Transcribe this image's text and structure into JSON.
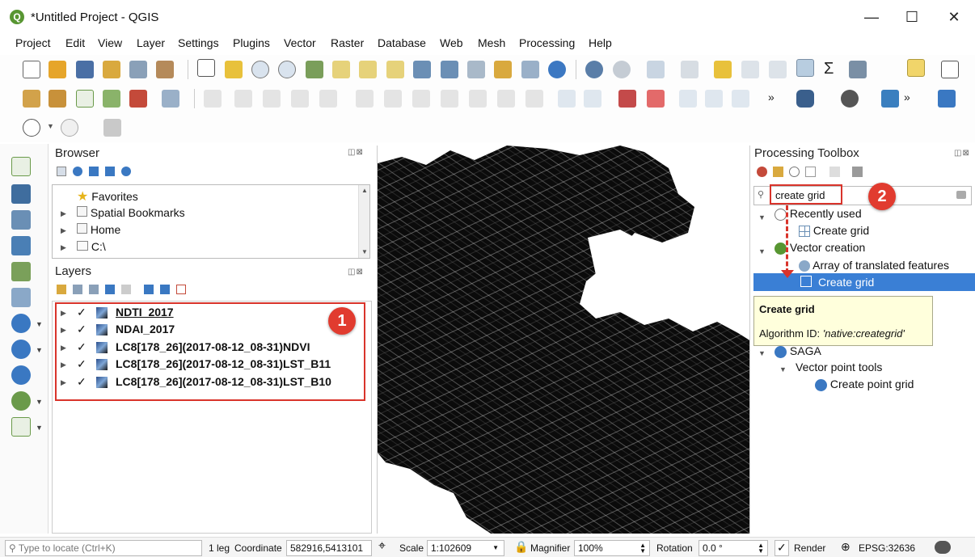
{
  "window": {
    "title": "*Untitled Project - QGIS",
    "logo_letter": "Q",
    "minimize": "—",
    "maximize": "☐",
    "close": "✕"
  },
  "menu": [
    "Project",
    "Edit",
    "View",
    "Layer",
    "Settings",
    "Plugins",
    "Vector",
    "Raster",
    "Database",
    "Web",
    "Mesh",
    "Processing",
    "Help"
  ],
  "browser": {
    "title": "Browser",
    "items": [
      {
        "label": "Favorites",
        "icon": "star-icon"
      },
      {
        "label": "Spatial Bookmarks",
        "icon": "bookmark-icon"
      },
      {
        "label": "Home",
        "icon": "home-folder-icon"
      },
      {
        "label": "C:\\",
        "icon": "folder-icon"
      }
    ]
  },
  "layers": {
    "title": "Layers",
    "items": [
      {
        "name": "NDTI_2017",
        "checked": true
      },
      {
        "name": "NDAI_2017",
        "checked": true
      },
      {
        "name": "LC8[178_26](2017-08-12_08-31)NDVI",
        "checked": true
      },
      {
        "name": "LC8[178_26](2017-08-12_08-31)LST_B11",
        "checked": true
      },
      {
        "name": "LC8[178_26](2017-08-12_08-31)LST_B10",
        "checked": true
      }
    ],
    "checkmark": "✓"
  },
  "toolbox": {
    "title": "Processing Toolbox",
    "search_value": "create grid",
    "groups": [
      {
        "label": "Recently used",
        "children": [
          "Create grid"
        ]
      },
      {
        "label": "Vector creation",
        "children": [
          "Array of translated features",
          "Create grid"
        ]
      },
      {
        "label": "SAGA",
        "children": []
      },
      {
        "label": "Vector point tools",
        "children": [
          "Create point grid"
        ]
      }
    ],
    "tooltip_title": "Create grid",
    "tooltip_prefix": "Algorithm ID: ",
    "tooltip_id": "'native:creategrid'"
  },
  "annotations": {
    "badge_1": "1",
    "badge_2": "2"
  },
  "status": {
    "locate_placeholder": "Type to locate (Ctrl+K)",
    "legend_text": "1 leg",
    "coordinate_label": "Coordinate",
    "coordinate_value": "582916,5413101",
    "scale_label": "Scale",
    "scale_value": "1:102609",
    "magnifier_label": "Magnifier",
    "magnifier_value": "100%",
    "rotation_label": "Rotation",
    "rotation_value": "0.0 °",
    "render_label": "Render",
    "crs": "EPSG:32636"
  },
  "colors": {
    "accent": "#3a7fd5",
    "annotation_red": "#d9342b",
    "qgis_green": "#589632"
  }
}
